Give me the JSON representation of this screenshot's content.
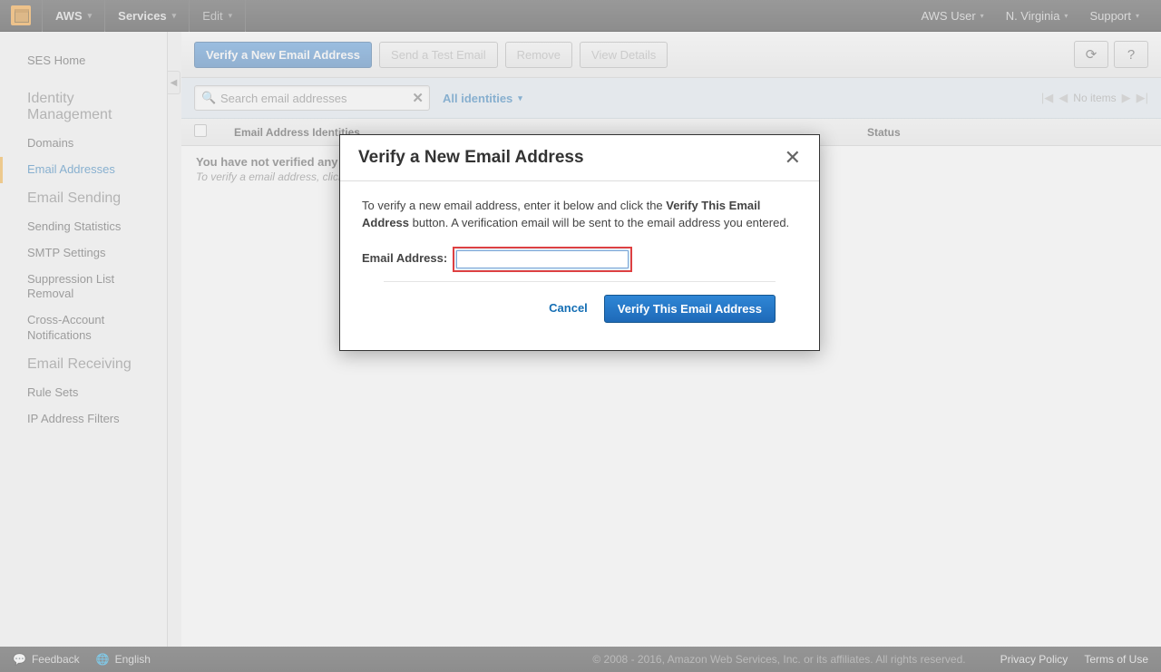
{
  "topnav": {
    "brand": "AWS",
    "services": "Services",
    "edit": "Edit",
    "user": "AWS User",
    "region": "N. Virginia",
    "support": "Support"
  },
  "sidebar": {
    "home": "SES Home",
    "group1_title": "Identity Management",
    "group1": {
      "domains": "Domains",
      "emails": "Email Addresses"
    },
    "group2_title": "Email Sending",
    "group2": {
      "stats": "Sending Statistics",
      "smtp": "SMTP Settings",
      "suppression": "Suppression List Removal",
      "cross": "Cross-Account Notifications"
    },
    "group3_title": "Email Receiving",
    "group3": {
      "rulesets": "Rule Sets",
      "ipfilters": "IP Address Filters"
    }
  },
  "toolbar": {
    "verify": "Verify a New Email Address",
    "sendtest": "Send a Test Email",
    "remove": "Remove",
    "view": "View Details"
  },
  "filter": {
    "search_placeholder": "Search email addresses",
    "dropdown": "All identities",
    "pager_label": "No items"
  },
  "table": {
    "col_identity": "Email Address Identities",
    "col_status": "Status"
  },
  "empty": {
    "title": "You have not verified any email addresses.",
    "sub": "To verify a email address, click the Verify a New Email Address button."
  },
  "modal": {
    "title": "Verify a New Email Address",
    "par1a": "To verify a new email address, enter it below and click the ",
    "par1b": "Verify This Email Address",
    "par1c": " button. A verification email will be sent to the email address you entered.",
    "label": "Email Address:",
    "input_value": "",
    "cancel": "Cancel",
    "verify": "Verify This Email Address"
  },
  "footer": {
    "feedback": "Feedback",
    "language": "English",
    "copyright": "© 2008 - 2016, Amazon Web Services, Inc. or its affiliates. All rights reserved.",
    "privacy": "Privacy Policy",
    "terms": "Terms of Use"
  }
}
